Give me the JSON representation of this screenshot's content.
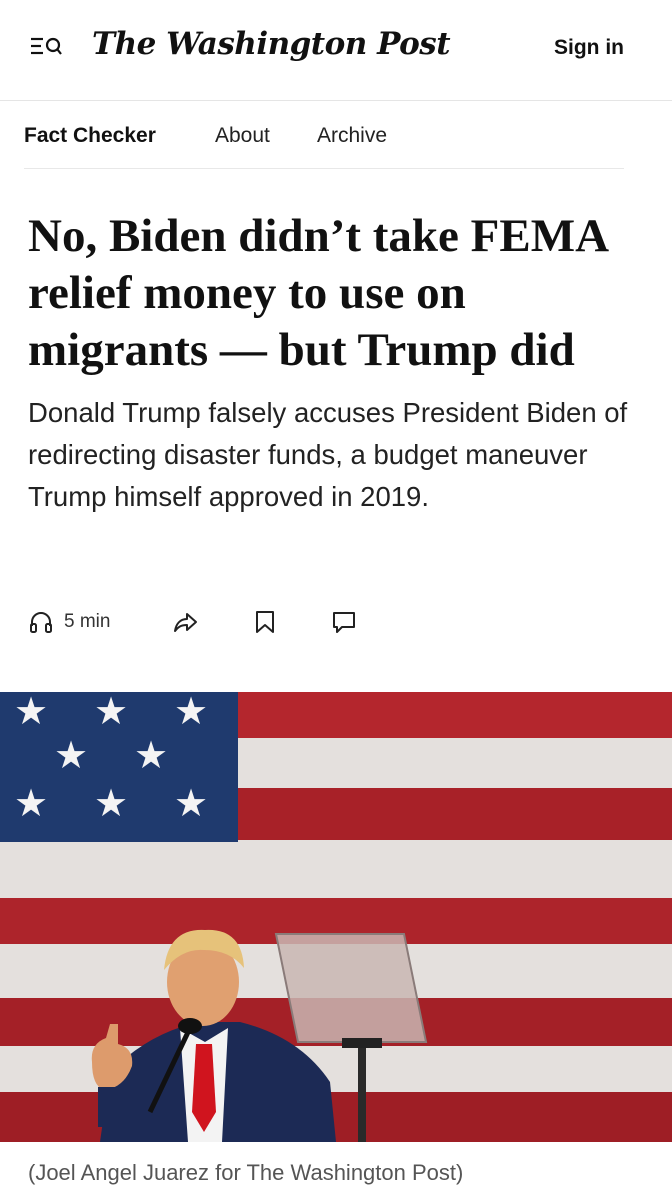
{
  "header": {
    "logo_text": "The Washington Post",
    "sign_in_label": "Sign in",
    "menu_icon": "menu-search-icon"
  },
  "subnav": {
    "section": "Fact Checker",
    "about": "About",
    "archive": "Archive"
  },
  "article": {
    "headline": "No, Biden didn’t take FEMA relief money to use on migrants — but Trump did",
    "dek": "Donald Trump falsely accuses President Biden of redirecting disaster funds, a budget maneuver Trump himself approved in 2019.",
    "listen_label": "5 min",
    "tools": [
      "headphones-icon",
      "share-icon",
      "bookmark-icon",
      "comment-icon"
    ]
  },
  "photo": {
    "caption": "(Joel Angel Juarez for The Washington Post)"
  },
  "colors": {
    "flag_red": "#b4262d",
    "flag_blue": "#1f3a6e",
    "tie_red": "#d0141e",
    "suit_navy": "#1c2a55"
  }
}
